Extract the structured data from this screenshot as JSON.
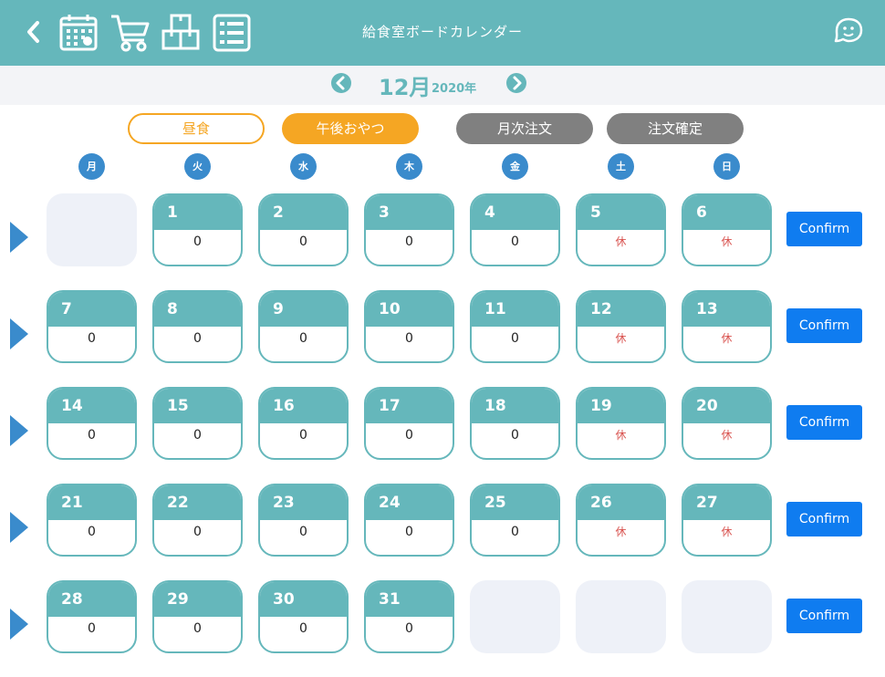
{
  "header": {
    "title": "給食室ボードカレンダー",
    "icons": [
      "back-chevron",
      "calendar",
      "cart",
      "boxes",
      "list",
      "chat"
    ]
  },
  "month_nav": {
    "month": "12月",
    "year": "2020年"
  },
  "tabs": [
    {
      "label": "昼食",
      "style": "outline"
    },
    {
      "label": "午後おやつ",
      "style": "filled"
    },
    {
      "label": "月次注文",
      "style": "gray"
    },
    {
      "label": "注文確定",
      "style": "gray"
    }
  ],
  "weekdays": [
    "月",
    "火",
    "水",
    "木",
    "金",
    "土",
    "日"
  ],
  "weeks": [
    {
      "confirm": "Confirm",
      "days": [
        null,
        {
          "day": "1",
          "value": "0"
        },
        {
          "day": "2",
          "value": "0"
        },
        {
          "day": "3",
          "value": "0"
        },
        {
          "day": "4",
          "value": "0"
        },
        {
          "day": "5",
          "value": "休",
          "holiday": true
        },
        {
          "day": "6",
          "value": "休",
          "holiday": true
        }
      ]
    },
    {
      "confirm": "Confirm",
      "days": [
        {
          "day": "7",
          "value": "0"
        },
        {
          "day": "8",
          "value": "0"
        },
        {
          "day": "9",
          "value": "0"
        },
        {
          "day": "10",
          "value": "0"
        },
        {
          "day": "11",
          "value": "0"
        },
        {
          "day": "12",
          "value": "休",
          "holiday": true
        },
        {
          "day": "13",
          "value": "休",
          "holiday": true
        }
      ]
    },
    {
      "confirm": "Confirm",
      "days": [
        {
          "day": "14",
          "value": "0"
        },
        {
          "day": "15",
          "value": "0"
        },
        {
          "day": "16",
          "value": "0"
        },
        {
          "day": "17",
          "value": "0"
        },
        {
          "day": "18",
          "value": "0"
        },
        {
          "day": "19",
          "value": "休",
          "holiday": true
        },
        {
          "day": "20",
          "value": "休",
          "holiday": true
        }
      ]
    },
    {
      "confirm": "Confirm",
      "days": [
        {
          "day": "21",
          "value": "0"
        },
        {
          "day": "22",
          "value": "0"
        },
        {
          "day": "23",
          "value": "0"
        },
        {
          "day": "24",
          "value": "0"
        },
        {
          "day": "25",
          "value": "0"
        },
        {
          "day": "26",
          "value": "休",
          "holiday": true
        },
        {
          "day": "27",
          "value": "休",
          "holiday": true
        }
      ]
    },
    {
      "confirm": "Confirm",
      "days": [
        {
          "day": "28",
          "value": "0"
        },
        {
          "day": "29",
          "value": "0"
        },
        {
          "day": "30",
          "value": "0"
        },
        {
          "day": "31",
          "value": "0"
        },
        null,
        null,
        null
      ]
    }
  ],
  "colors": {
    "teal": "#65b7bb",
    "orange": "#f5a623",
    "gray": "#808080",
    "weekday_blue": "#3a8bcc",
    "confirm_blue": "#0f7cf0",
    "holiday_red": "#d9534f",
    "empty_cell": "#eef1f8"
  }
}
